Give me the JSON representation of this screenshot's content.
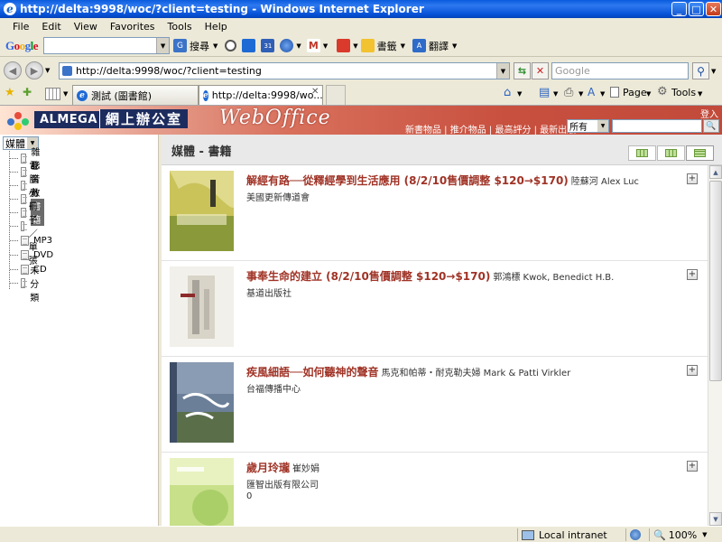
{
  "window": {
    "title": "http://delta:9998/woc/?client=testing - Windows Internet Explorer",
    "minimize": "_",
    "maximize": "□",
    "close": "✕"
  },
  "menu": [
    "File",
    "Edit",
    "View",
    "Favorites",
    "Tools",
    "Help"
  ],
  "google_toolbar": {
    "logo": "Google",
    "search_label": "搜尋",
    "bookmarks_label": "書籤",
    "translate_label": "翻譯"
  },
  "address_bar": {
    "url": "http://delta:9998/woc/?client=testing",
    "search_placeholder": "Google"
  },
  "tabs": [
    {
      "label": "測試 (圖書館)",
      "active": false
    },
    {
      "label": "http://delta:9998/wo...",
      "active": true
    }
  ],
  "command_bar": {
    "page_label": "Page",
    "tools_label": "Tools"
  },
  "site_header": {
    "brand": "ALMEGA",
    "brand_cn": "網上辦公室",
    "product": "WebOffice",
    "links": "新書物品 | 推介物品 | 最高評分 | 最新出版",
    "filter_value": "所有",
    "login": "登入"
  },
  "sidebar": {
    "category_select": "媒體",
    "items": [
      {
        "label": "雜誌",
        "selected": false
      },
      {
        "label": "影音",
        "selected": false
      },
      {
        "label": "電腦光碟",
        "selected": false
      },
      {
        "label": "教材",
        "selected": false
      },
      {
        "label": "書籍",
        "selected": true
      },
      {
        "label": "小冊子／單張",
        "selected": false
      },
      {
        "label": "MP3",
        "selected": false
      },
      {
        "label": "DVD",
        "selected": false
      },
      {
        "label": "CD",
        "selected": false
      },
      {
        "label": "未分類",
        "selected": false
      }
    ]
  },
  "main": {
    "title": "媒體 - 書籍",
    "books": [
      {
        "title": "解經有路──從釋經學到生活應用 (8/2/10售價調整 $120→$170)",
        "author": "陸蘇河 Alex Luc",
        "publisher": "美國更新傳道會",
        "extra": "",
        "cover_color": "#c9c35a"
      },
      {
        "title": "事奉生命的建立 (8/2/10售價調整 $120→$170)",
        "author": "郭鴻標 Kwok, Benedict H.B.",
        "publisher": "基道出版社",
        "extra": "",
        "cover_color": "#e8e6e0"
      },
      {
        "title": "疾風細語──如何聽神的聲音",
        "author": "馬克和帕蒂・耐克勒夫婦 Mark & Patti Virkler",
        "publisher": "台福傳播中心",
        "extra": "",
        "cover_color": "#6b7f99"
      },
      {
        "title": "歲月玲瓏",
        "author": "崔妙娟",
        "publisher": "匯智出版有限公司",
        "extra": "0",
        "cover_color": "#b7d77a"
      }
    ],
    "add_symbol": "+"
  },
  "status_bar": {
    "zone": "Local intranet",
    "zoom": "100%"
  }
}
